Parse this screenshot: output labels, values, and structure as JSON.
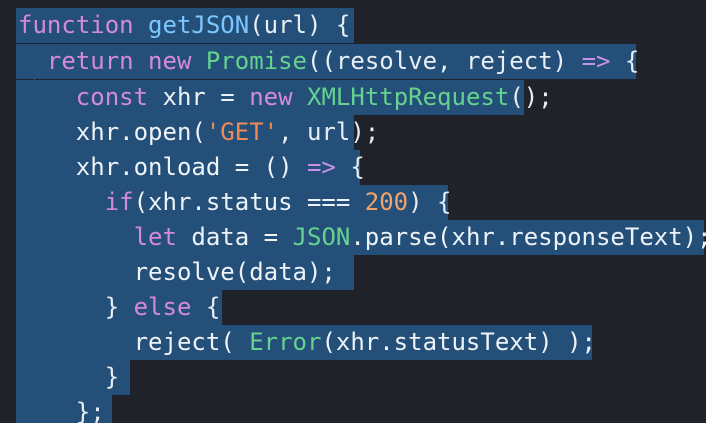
{
  "code_lines": [
    {
      "tokens": [
        {
          "text": "function",
          "kind": "kw"
        },
        {
          "text": " ",
          "kind": "plain"
        },
        {
          "text": "getJSON",
          "kind": "fn"
        },
        {
          "text": "(url) {",
          "kind": "punc"
        }
      ]
    },
    {
      "tokens": [
        {
          "text": "  return",
          "kind": "kw"
        },
        {
          "text": " ",
          "kind": "plain"
        },
        {
          "text": "new",
          "kind": "kw"
        },
        {
          "text": " ",
          "kind": "plain"
        },
        {
          "text": "Promise",
          "kind": "cls"
        },
        {
          "text": "((resolve, reject) ",
          "kind": "punc"
        },
        {
          "text": "=>",
          "kind": "op"
        },
        {
          "text": " {",
          "kind": "punc"
        }
      ]
    },
    {
      "tokens": [
        {
          "text": "    const",
          "kind": "kw"
        },
        {
          "text": " xhr = ",
          "kind": "plain"
        },
        {
          "text": "new",
          "kind": "kw"
        },
        {
          "text": " ",
          "kind": "plain"
        },
        {
          "text": "XMLHttpRequest",
          "kind": "cls"
        },
        {
          "text": "();",
          "kind": "punc"
        }
      ]
    },
    {
      "tokens": [
        {
          "text": "    xhr.open(",
          "kind": "plain"
        },
        {
          "text": "'GET'",
          "kind": "str"
        },
        {
          "text": ", url);",
          "kind": "punc"
        }
      ]
    },
    {
      "tokens": [
        {
          "text": "    xhr.onload = () ",
          "kind": "plain"
        },
        {
          "text": "=>",
          "kind": "op"
        },
        {
          "text": " {",
          "kind": "punc"
        }
      ]
    },
    {
      "tokens": [
        {
          "text": "      if",
          "kind": "kw"
        },
        {
          "text": "(xhr.status === ",
          "kind": "plain"
        },
        {
          "text": "200",
          "kind": "num"
        },
        {
          "text": ") {",
          "kind": "punc"
        }
      ]
    },
    {
      "tokens": [
        {
          "text": "        let",
          "kind": "kw"
        },
        {
          "text": " data = ",
          "kind": "plain"
        },
        {
          "text": "JSON",
          "kind": "cls"
        },
        {
          "text": ".parse(xhr.responseText);",
          "kind": "plain"
        }
      ]
    },
    {
      "tokens": [
        {
          "text": "        resolve(data);",
          "kind": "plain"
        }
      ]
    },
    {
      "tokens": [
        {
          "text": "      } ",
          "kind": "punc"
        },
        {
          "text": "else",
          "kind": "kw"
        },
        {
          "text": " {",
          "kind": "punc"
        }
      ]
    },
    {
      "tokens": [
        {
          "text": "        reject( ",
          "kind": "plain"
        },
        {
          "text": "Error",
          "kind": "cls"
        },
        {
          "text": "(xhr.statusText) );",
          "kind": "plain"
        }
      ]
    },
    {
      "tokens": [
        {
          "text": "      }",
          "kind": "punc"
        }
      ]
    },
    {
      "tokens": [
        {
          "text": "    };",
          "kind": "punc"
        }
      ]
    }
  ]
}
